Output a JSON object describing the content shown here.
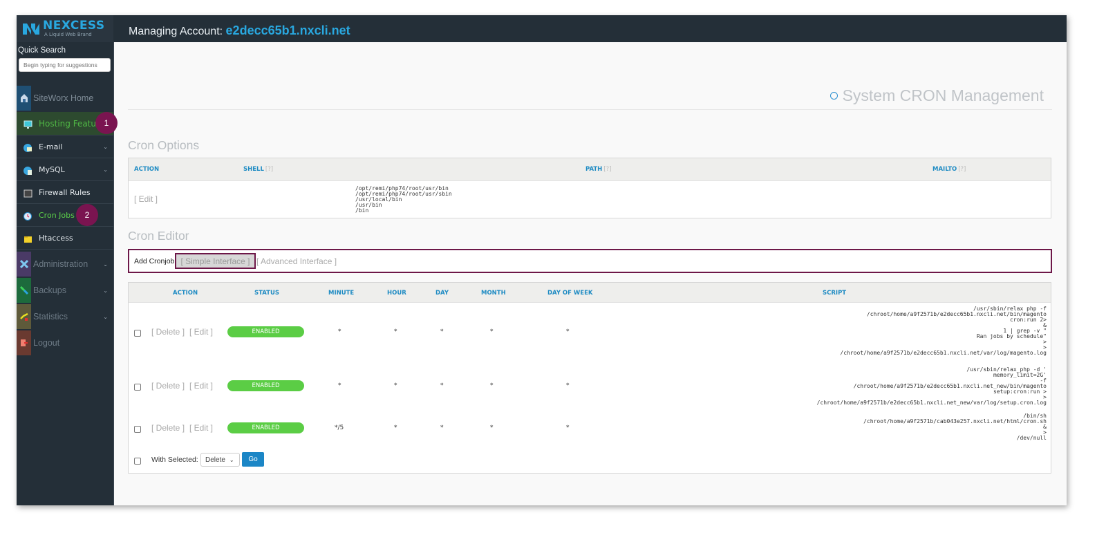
{
  "brand": {
    "name": "NEXCESS",
    "tagline": "A Liquid Web Brand"
  },
  "header": {
    "prefix": "Managing Account:",
    "account": "e2decc65b1.nxcli.net"
  },
  "sidebar": {
    "quick_search_label": "Quick Search",
    "quick_search_placeholder": "Begin typing for suggestions",
    "home": "SiteWorx Home",
    "hosting": "Hosting Features",
    "items": [
      {
        "label": "E-mail",
        "expandable": true
      },
      {
        "label": "MySQL",
        "expandable": true
      },
      {
        "label": "Firewall Rules",
        "expandable": false
      },
      {
        "label": "Cron Jobs",
        "expandable": false,
        "active": true
      },
      {
        "label": "Htaccess",
        "expandable": false
      }
    ],
    "sections": [
      {
        "label": "Administration",
        "color": "#4a3a66"
      },
      {
        "label": "Backups",
        "color": "#1d6a3c"
      },
      {
        "label": "Statistics",
        "color": "#5e5a3a"
      },
      {
        "label": "Logout",
        "color": "#6a3a30"
      }
    ],
    "annotations": [
      "1",
      "2"
    ]
  },
  "page": {
    "title": "System CRON Management"
  },
  "cron_options": {
    "heading": "Cron Options",
    "headers": {
      "action": "ACTION",
      "shell": "SHELL",
      "path": "PATH",
      "mailto": "MAILTO",
      "help": "[?]"
    },
    "edit": "[ Edit ]",
    "path_value": "/opt/remi/php74/root/usr/bin\n/opt/remi/php74/root/usr/sbin\n/usr/local/bin\n/usr/bin\n/bin"
  },
  "cron_editor": {
    "heading": "Cron Editor",
    "add_label": "Add Cronjob:",
    "simple": "[ Simple Interface ]",
    "advanced": "[ Advanced Interface ]",
    "headers": [
      "ACTION",
      "STATUS",
      "MINUTE",
      "HOUR",
      "DAY",
      "MONTH",
      "DAY OF WEEK",
      "SCRIPT"
    ],
    "delete": "[ Delete ]",
    "edit": "[ Edit ]",
    "rows": [
      {
        "status": "ENABLED",
        "minute": "*",
        "hour": "*",
        "day": "*",
        "month": "*",
        "dow": "*",
        "script": "/usr/sbin/relax php -f\n/chroot/home/a9f2571b/e2decc65b1.nxcli.net/bin/magento\ncron:run 2>\n&\n1 | grep -v \"\nRan jobs by schedule\"\n>\n>\n/chroot/home/a9f2571b/e2decc65b1.nxcli.net/var/log/magento.log"
      },
      {
        "status": "ENABLED",
        "minute": "*",
        "hour": "*",
        "day": "*",
        "month": "*",
        "dow": "*",
        "script": "/usr/sbin/relax_php -d '\nmemory_limit=2G'\n-f\n/chroot/home/a9f2571b/e2decc65b1.nxcli.net_new/bin/magento\nsetup:cron:run >\n>\n/chroot/home/a9f2571b/e2decc65b1.nxcli.net_new/var/log/setup.cron.log"
      },
      {
        "status": "ENABLED",
        "minute": "*/5",
        "hour": "*",
        "day": "*",
        "month": "*",
        "dow": "*",
        "script": "/bin/sh\n/chroot/home/a9f2571b/cab043e257.nxcli.net/html/cron.sh\n&\n>\n/dev/null"
      }
    ],
    "with_selected": "With Selected:",
    "bulk_action": "Delete",
    "go": "Go"
  },
  "colors": {
    "accent": "#1e8bc3",
    "enabled": "#5bcd45",
    "highlight": "#6d1748",
    "sidebar": "#242f38"
  }
}
